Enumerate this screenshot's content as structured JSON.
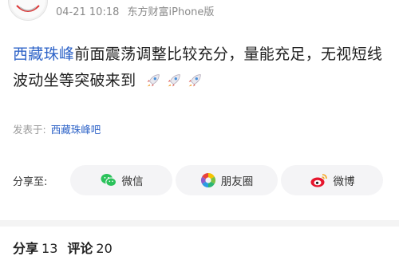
{
  "post": {
    "date": "04-21 10:18",
    "source": "东方财富iPhone版",
    "stock_name": "西藏珠峰",
    "text": "前面震荡调整比较充分，量能充足，无视短线波动坐等突破来到",
    "emoji": [
      "rocket-icon",
      "rocket-icon",
      "rocket-icon"
    ]
  },
  "posted_in": {
    "label": "发表于:",
    "bar_name": "西藏珠峰吧"
  },
  "share": {
    "label": "分享至:",
    "buttons": [
      {
        "label": "微信",
        "icon": "wechat-icon",
        "color": "#2bc25b"
      },
      {
        "label": "朋友圈",
        "icon": "moments-icon"
      },
      {
        "label": "微博",
        "icon": "weibo-icon",
        "color": "#e6162d"
      }
    ]
  },
  "stats": {
    "share_label": "分享",
    "share_count": "13",
    "comment_label": "评论",
    "comment_count": "20"
  }
}
